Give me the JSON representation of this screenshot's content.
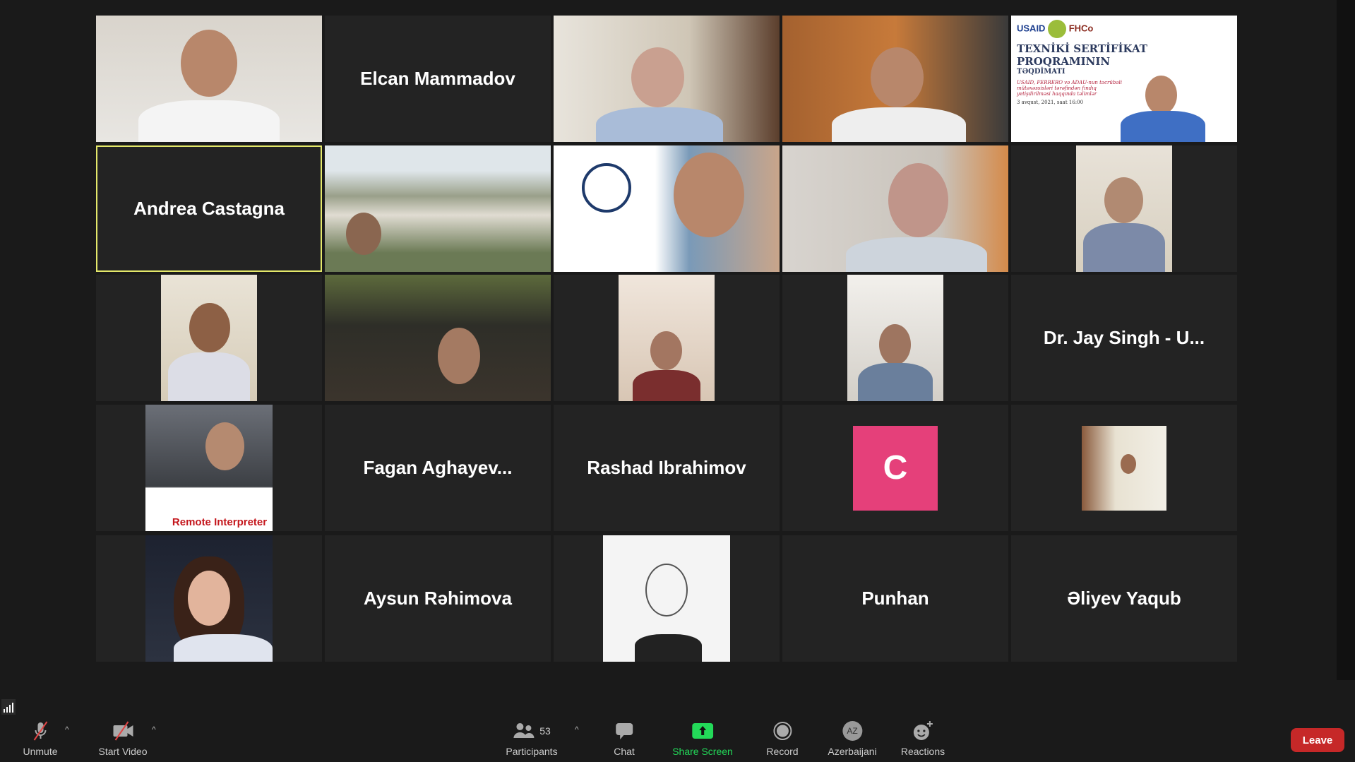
{
  "tiles": {
    "elcan": "Elcan Mammadov",
    "andrea": "Andrea Castagna",
    "jay": "Dr. Jay Singh - U...",
    "fagan": "Fagan  Aghayev...",
    "rashad": "Rashad Ibrahimov",
    "c_initial": "C",
    "aysun": "Aysun Rəhimova",
    "punhan": "Punhan",
    "eliyev": "Əliyev Yaqub",
    "remote_interpreter": "Remote Interpreter"
  },
  "slide": {
    "logos": [
      "USAID",
      "FHCo"
    ],
    "title1": "TEXNİKİ SERTİFİKAT",
    "title2": "PROQRAMININ",
    "title3": "TƏQDİMATI",
    "subtitle": "USAID, FERRERO və ADAU-nun təcrübəli mütəxəssisləri tərəfindən fındıq yetişdirilməsi haqqında təlimlər",
    "date": "3 avqust, 2021, saat 16:00"
  },
  "toolbar": {
    "unmute": "Unmute",
    "start_video": "Start Video",
    "participants": "Participants",
    "participants_count": "53",
    "chat": "Chat",
    "share_screen": "Share Screen",
    "record": "Record",
    "language": "Azerbaijani",
    "language_code": "AZ",
    "reactions": "Reactions",
    "leave": "Leave"
  },
  "colors": {
    "active_speaker": "#e4e86a",
    "share": "#23d959",
    "leave": "#c62828",
    "avatar_c": "#e5407a"
  }
}
